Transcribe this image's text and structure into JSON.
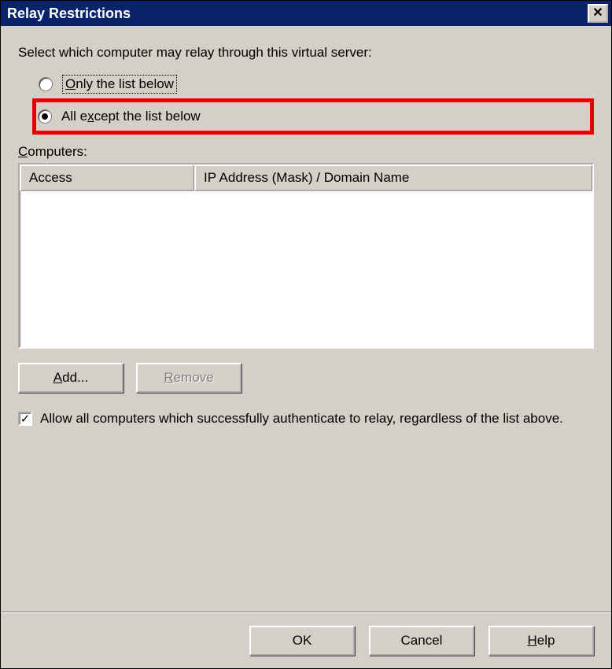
{
  "title": "Relay Restrictions",
  "prompt": "Select which computer may relay through this virtual server:",
  "radios": {
    "only": {
      "pre": "",
      "hot": "O",
      "rest": "nly the list below",
      "selected": false
    },
    "except": {
      "pre": "All e",
      "hot": "x",
      "rest": "cept the list below",
      "selected": true
    }
  },
  "computers_label": {
    "hot": "C",
    "rest": "omputers:"
  },
  "columns": {
    "access": "Access",
    "ip": "IP Address (Mask) / Domain Name"
  },
  "buttons": {
    "add": {
      "hot": "A",
      "rest": "dd..."
    },
    "remove": {
      "hot": "R",
      "rest": "emove",
      "disabled": true
    },
    "ok": "OK",
    "cancel": "Cancel",
    "help": {
      "hot": "H",
      "rest": "elp"
    }
  },
  "checkbox": {
    "checked": true,
    "text": "Allow all computers which successfully authenticate to relay, regardless of the list above."
  }
}
